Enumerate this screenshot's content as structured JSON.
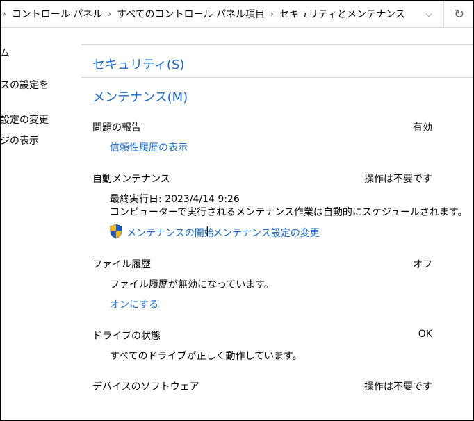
{
  "address_bar": {
    "crumbs": [
      "コントロール パネル",
      "すべてのコントロール パネル項目",
      "セキュリティとメンテナンス"
    ]
  },
  "sidebar": {
    "items": [
      "ム",
      "スの設定を",
      "設定の変更",
      "ジの表示"
    ]
  },
  "security": {
    "title": "セキュリティ(S)"
  },
  "maintenance": {
    "title": "メンテナンス(M)",
    "problem_reports": {
      "label": "問題の報告",
      "status": "有効",
      "link": "信頼性履歴の表示"
    },
    "auto_maintenance": {
      "label": "自動メンテナンス",
      "status": "操作は不要です",
      "last_run": "最終実行日: 2023/4/14 9:26",
      "description": "コンピューターで実行されるメンテナンス作業は自動的にスケジュールされます。",
      "start_link": "メンテナンスの開始",
      "separator": "|",
      "settings_link": "メンテナンス設定の変更"
    },
    "file_history": {
      "label": "ファイル履歴",
      "status": "オフ",
      "description": "ファイル履歴が無効になっています。",
      "link": "オンにする"
    },
    "drive_status": {
      "label": "ドライブの状態",
      "status": "OK",
      "description": "すべてのドライブが正しく動作しています。"
    },
    "device_software": {
      "label": "デバイスのソフトウェア",
      "status": "操作は不要です"
    }
  },
  "colors": {
    "link": "#1a68c3",
    "divider": "#d4d4d4"
  }
}
